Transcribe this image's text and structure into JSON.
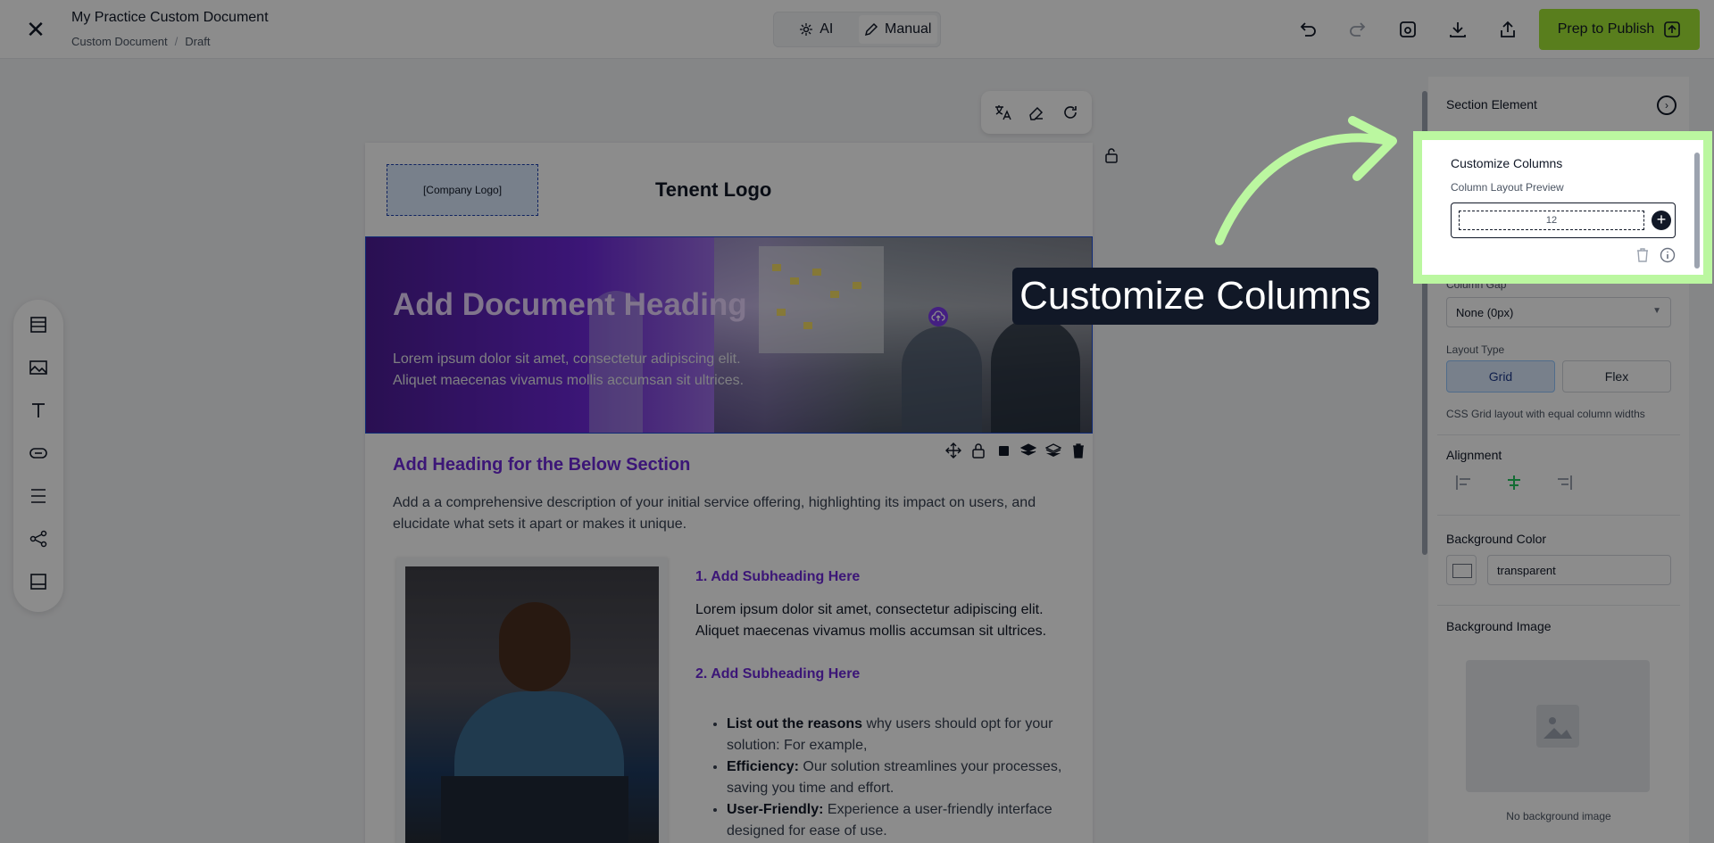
{
  "header": {
    "close_label": "✕",
    "title": "My Practice Custom Document",
    "breadcrumb": [
      "Custom Document",
      "Draft"
    ],
    "modes": [
      {
        "label": "AI",
        "active": false
      },
      {
        "label": "Manual",
        "active": true
      }
    ],
    "publish_label": "Prep to Publish",
    "accent_color": "#a3e635"
  },
  "left_toolbar": {
    "icons": [
      "section-icon",
      "image-icon",
      "text-icon",
      "button-icon",
      "divider-icon",
      "share-icon",
      "footer-icon"
    ]
  },
  "document": {
    "company_logo": "[Company Logo]",
    "tenant_logo": "Tenent Logo",
    "hero_heading": "Add Document Heading",
    "hero_text": "Lorem ipsum dolor sit amet, consectetur adipiscing elit. Aliquet maecenas vivamus mollis accumsan sit ultrices.",
    "section_heading": "Add Heading for the Below Section",
    "section_desc": "Add a a comprehensive description of your initial service offering, highlighting its impact on users, and elucidate what sets it apart or makes it unique.",
    "subheading_1": "1. Add Subheading Here",
    "para_1": "Lorem ipsum dolor sit amet, consectetur adipiscing elit. Aliquet maecenas vivamus mollis accumsan sit ultrices.",
    "subheading_2": "2. Add Subheading Here",
    "bullets": [
      {
        "bold": "List out the reasons",
        "text": " why users should opt for your solution: For example,"
      },
      {
        "bold": "Efficiency:",
        "text": " Our solution streamlines your processes, saving you time and effort."
      },
      {
        "bold": "User-Friendly:",
        "text": " Experience a user-friendly interface designed for ease of use."
      }
    ]
  },
  "panel": {
    "title": "Section Element",
    "customize_title": "Customize Columns",
    "column_preview_label": "Column Layout Preview",
    "column_value": "12",
    "column_gap_label": "Column Gap",
    "column_gap_value": "None (0px)",
    "layout_type_label": "Layout Type",
    "layout_grid": "Grid",
    "layout_flex": "Flex",
    "layout_hint": "CSS Grid layout with equal column widths",
    "alignment_label": "Alignment",
    "bg_color_label": "Background Color",
    "bg_color_value": "transparent",
    "bg_image_label": "Background Image",
    "bg_image_caption": "No background image"
  },
  "tooltip": {
    "text": "Customize Columns"
  }
}
